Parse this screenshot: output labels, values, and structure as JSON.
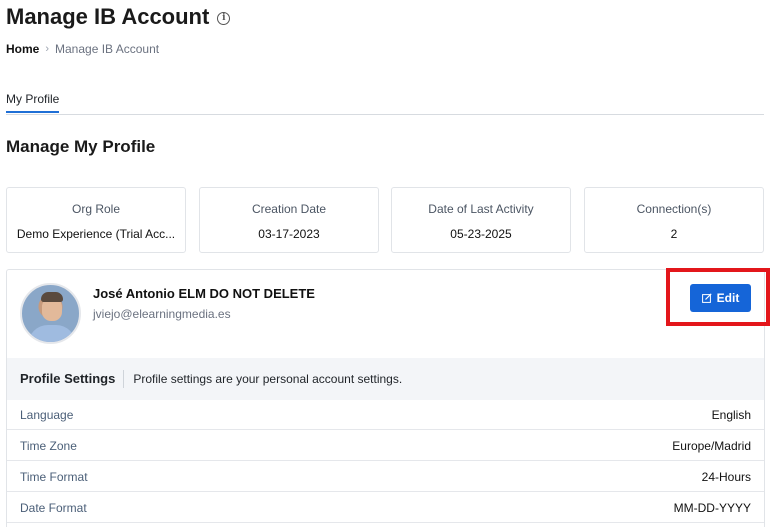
{
  "header": {
    "title": "Manage IB Account"
  },
  "breadcrumb": {
    "home": "Home",
    "current": "Manage IB Account"
  },
  "tabs": [
    {
      "label": "My Profile",
      "active": true
    }
  ],
  "section": {
    "title": "Manage My Profile"
  },
  "stats": [
    {
      "label": "Org Role",
      "value": "Demo Experience (Trial Acc..."
    },
    {
      "label": "Creation Date",
      "value": "03-17-2023"
    },
    {
      "label": "Date of Last Activity",
      "value": "05-23-2025"
    },
    {
      "label": "Connection(s)",
      "value": "2"
    }
  ],
  "profile": {
    "name": "José Antonio ELM DO NOT DELETE",
    "email": "jviejo@elearningmedia.es",
    "edit_label": "Edit"
  },
  "settings": {
    "title": "Profile Settings",
    "description": "Profile settings are your personal account settings.",
    "rows": [
      {
        "label": "Language",
        "value": "English"
      },
      {
        "label": "Time Zone",
        "value": "Europe/Madrid"
      },
      {
        "label": "Time Format",
        "value": "24-Hours"
      },
      {
        "label": "Date Format",
        "value": "MM-DD-YYYY"
      }
    ]
  },
  "colors": {
    "accent": "#1565d8",
    "highlight": "#e3161b"
  }
}
